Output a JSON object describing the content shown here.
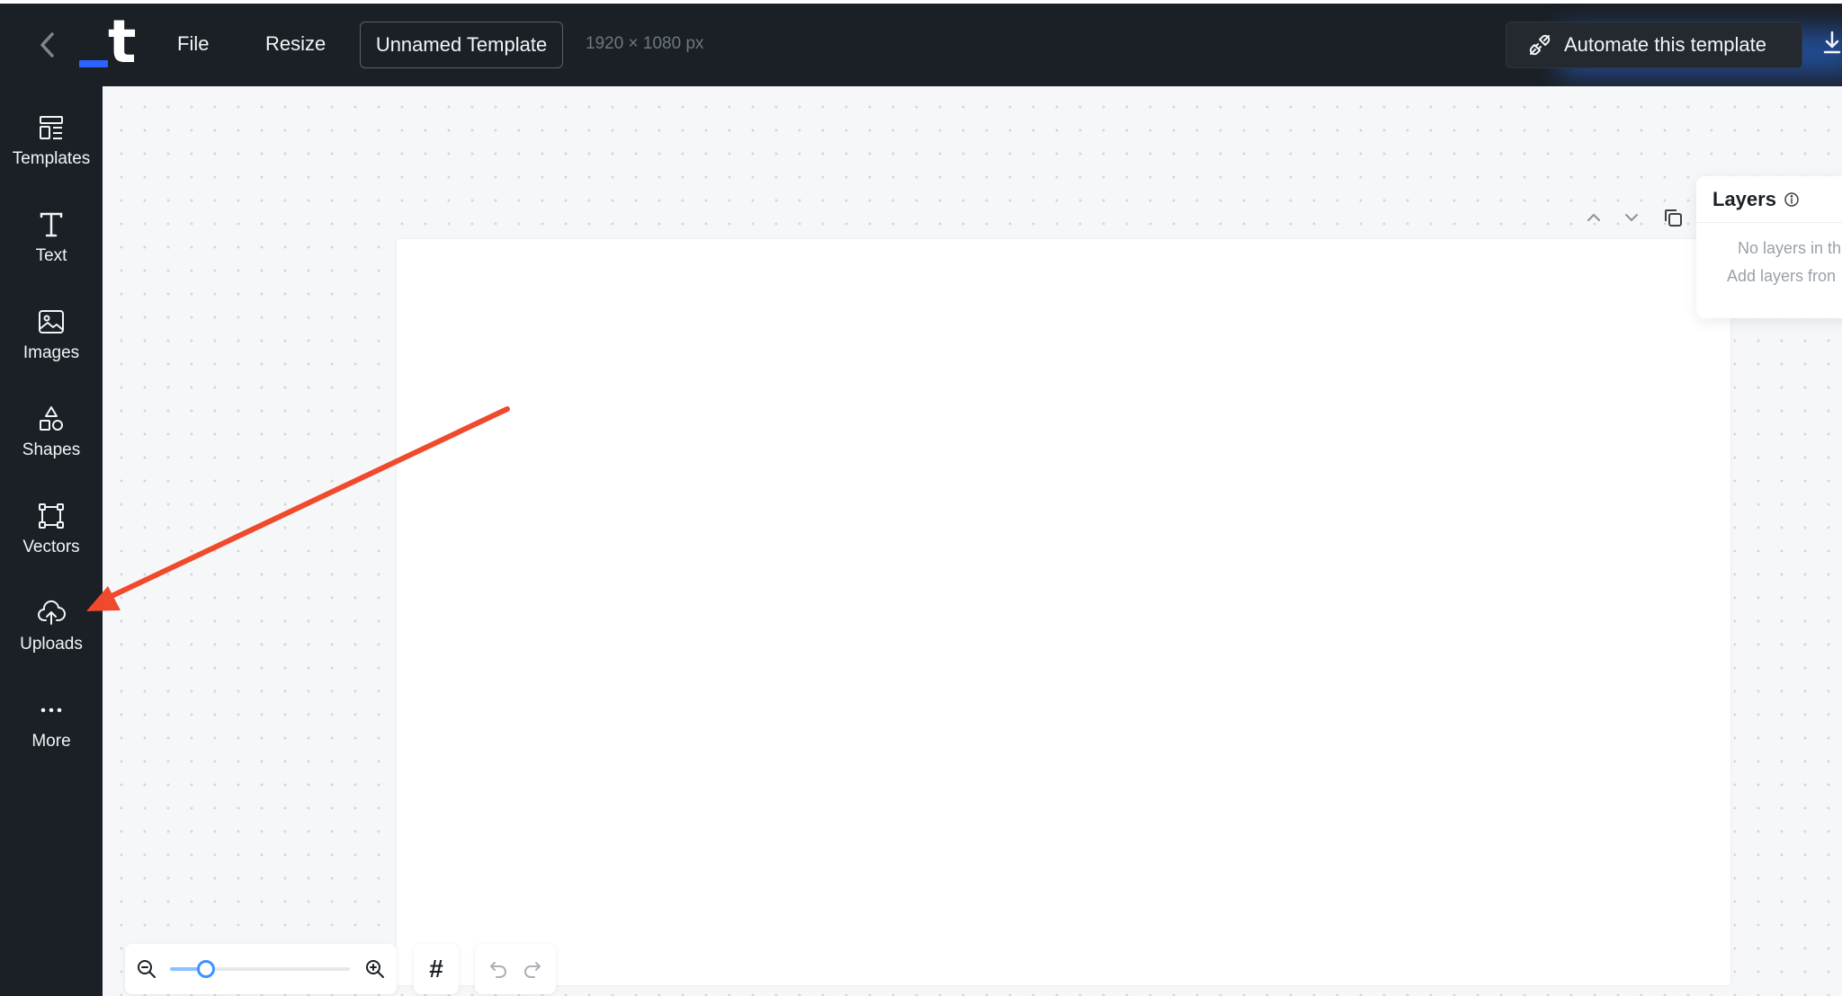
{
  "header": {
    "menu": {
      "file": "File",
      "resize": "Resize"
    },
    "template_name": "Unnamed Template",
    "canvas_size": "1920 × 1080 px",
    "automate_label": "Automate this template",
    "icons": {
      "back": "chevron-left-icon",
      "automate": "plug-icon",
      "download": "download-icon"
    }
  },
  "sidebar": {
    "items": [
      {
        "label": "Templates",
        "icon": "templates-icon"
      },
      {
        "label": "Text",
        "icon": "text-icon"
      },
      {
        "label": "Images",
        "icon": "image-icon"
      },
      {
        "label": "Shapes",
        "icon": "shapes-icon"
      },
      {
        "label": "Vectors",
        "icon": "vector-icon"
      },
      {
        "label": "Uploads",
        "icon": "cloud-upload-icon"
      },
      {
        "label": "More",
        "icon": "more-icon"
      }
    ]
  },
  "layers": {
    "title": "Layers",
    "empty_line1": "No layers in th",
    "empty_line2": "Add layers fron"
  },
  "zoom": {
    "level": 0.2
  },
  "grid_symbol": "#",
  "colors": {
    "annotation_arrow": "#ef4a2c",
    "accent": "#2b63ff",
    "toolbar_bg": "#1b2026"
  }
}
